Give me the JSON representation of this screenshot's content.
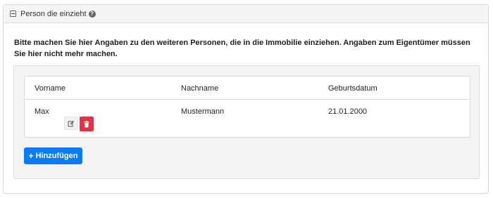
{
  "section": {
    "title": "Person die einzieht",
    "help_icon": "?",
    "collapse_icon": "collapse-minus-icon"
  },
  "intro_text": "Bitte machen Sie hier Angaben zu den weiteren Personen, die in die Immobilie einziehen. Angaben zum Eigentümer müssen Sie hier nicht mehr machen.",
  "table": {
    "headers": [
      "Vorname",
      "Nachname",
      "Geburtsdatum"
    ],
    "rows": [
      {
        "vorname": "Max",
        "nachname": "Mustermann",
        "geburtsdatum": "21.01.2000"
      }
    ]
  },
  "actions": {
    "edit_icon": "edit-icon",
    "delete_icon": "trash-icon",
    "add_label": "Hinzufügen",
    "add_icon": "+"
  },
  "colors": {
    "primary": "#0d7cf2",
    "danger": "#dc3545",
    "header_bg": "#f5f5f5",
    "well_bg": "#f4f4f4"
  }
}
